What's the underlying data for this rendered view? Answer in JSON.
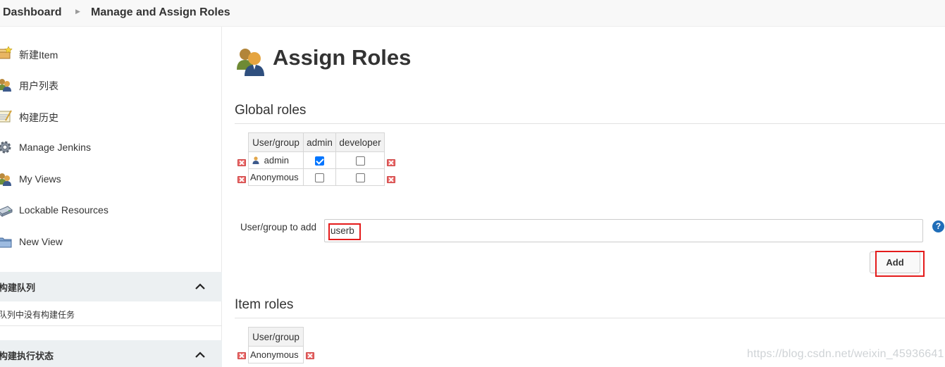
{
  "breadcrumb": {
    "items": [
      "Dashboard",
      "Manage and Assign Roles"
    ]
  },
  "sidebar": {
    "tasks": [
      {
        "label": "新建Item",
        "icon": "new-item-icon"
      },
      {
        "label": "用户列表",
        "icon": "people-icon"
      },
      {
        "label": "构建历史",
        "icon": "notepad-icon"
      },
      {
        "label": "Manage Jenkins",
        "icon": "gear-icon"
      },
      {
        "label": "My Views",
        "icon": "people-icon"
      },
      {
        "label": "Lockable Resources",
        "icon": "network-drive-icon"
      },
      {
        "label": "New View",
        "icon": "folder-icon"
      }
    ],
    "build_queue": {
      "title": "构建队列",
      "empty_text": "队列中没有构建任务"
    },
    "executors": {
      "title": "构建执行状态"
    }
  },
  "main": {
    "title": "Assign Roles",
    "global_roles": {
      "heading": "Global roles",
      "columns": [
        "User/group",
        "admin",
        "developer"
      ],
      "rows": [
        {
          "user": "admin",
          "admin": true,
          "developer": false
        },
        {
          "user": "Anonymous",
          "admin": false,
          "developer": false
        }
      ]
    },
    "add_user": {
      "label": "User/group to add",
      "value": "userb",
      "button": "Add",
      "help": "?"
    },
    "item_roles": {
      "heading": "Item roles",
      "columns": [
        "User/group"
      ],
      "rows": [
        {
          "user": "Anonymous"
        }
      ]
    }
  },
  "watermark": "https://blog.csdn.net/weixin_45936641",
  "colors": {
    "highlight": "#e41b1b",
    "checkbox": "#0075ff",
    "help": "#1f6db8"
  }
}
